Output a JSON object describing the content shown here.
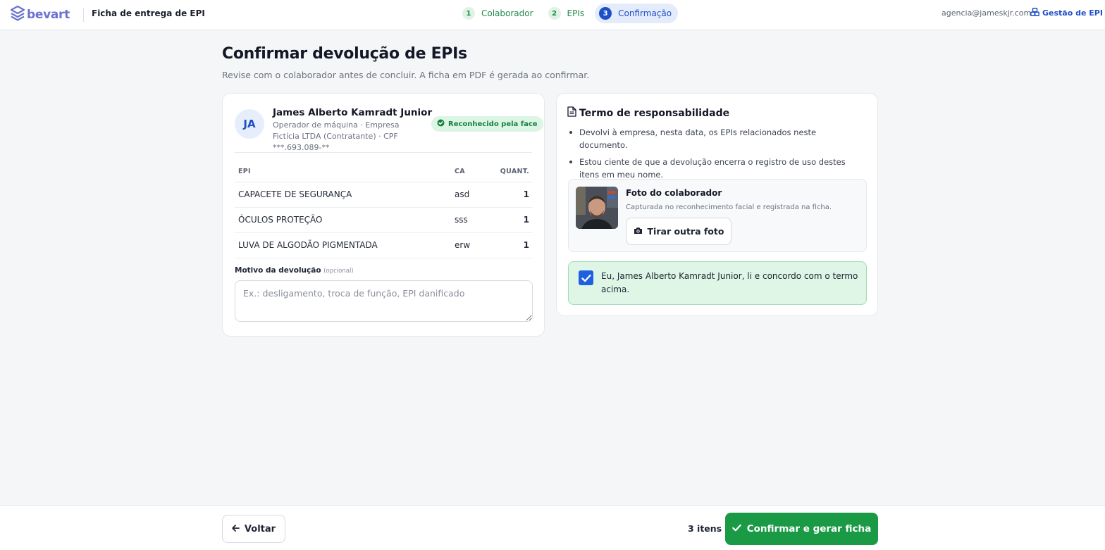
{
  "header": {
    "logo_text": "bevart",
    "app_title": "Ficha de entrega de EPI",
    "steps": [
      {
        "num": "1",
        "label": "Colaborador"
      },
      {
        "num": "2",
        "label": "EPIs"
      },
      {
        "num": "3",
        "label": "Confirmação"
      }
    ],
    "active_step": "3",
    "user_email": "agencia@jameskjr.com",
    "gestao_link": "Gestão de EPI"
  },
  "page": {
    "title": "Confirmar devolução de EPIs",
    "subtitle": "Revise com o colaborador antes de concluir. A ficha em PDF é gerada ao confirmar."
  },
  "employee": {
    "initials": "JA",
    "name": "James Alberto Kamradt Junior",
    "meta": "Operador de máquina · Empresa Fictícia LTDA (Contratante) · CPF ***.693.089-**",
    "face_badge": "Reconhecido pela face"
  },
  "table": {
    "headers": {
      "epi": "EPI",
      "ca": "CA",
      "qty": "QUANT."
    },
    "rows": [
      {
        "epi": "CAPACETE DE SEGURANÇA",
        "ca": "asd",
        "qty": "1"
      },
      {
        "epi": "ÓCULOS PROTEÇÃO",
        "ca": "sss",
        "qty": "1"
      },
      {
        "epi": "LUVA DE ALGODÃO PIGMENTADA",
        "ca": "erw",
        "qty": "1"
      }
    ]
  },
  "motivo": {
    "label": "Motivo da devolução",
    "optional": "(opcional)",
    "value": "",
    "placeholder": "Ex.: desligamento, troca de função, EPI danificado"
  },
  "term": {
    "title": "Termo de responsabilidade",
    "items": [
      "Devolvi à empresa, nesta data, os EPIs relacionados neste documento.",
      "Estou ciente de que a devolução encerra o registro de uso destes itens em meu nome."
    ],
    "photo_title": "Foto do colaborador",
    "photo_subtitle": "Capturada no reconhecimento facial e registrada na ficha.",
    "retake_label": "Tirar outra foto",
    "agree_text": "Eu, James Alberto Kamradt Junior, li e concordo com o termo acima.",
    "agree_checked": true
  },
  "footer": {
    "back_label": "Voltar",
    "item_count": "3 itens",
    "confirm_label": "Confirmar e gerar ficha"
  },
  "colors": {
    "brand": "#6a73cf",
    "primary": "#1f4fc7",
    "success": "#1b9a46"
  },
  "icons": {
    "logo": "layers-icon",
    "gestao": "cubes-icon",
    "badge": "check-circle-icon",
    "term": "document-icon",
    "retake": "camera-icon",
    "back": "arrow-left-icon",
    "confirm": "check-icon"
  }
}
